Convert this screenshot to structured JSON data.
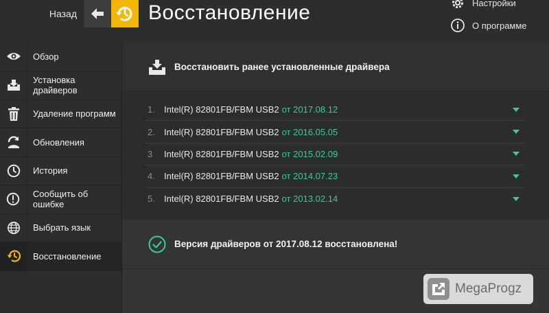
{
  "header": {
    "back_label": "Назад",
    "title": "Восстановление",
    "settings_label": "Настройки",
    "about_label": "О программе",
    "accent_color": "#f2b705"
  },
  "sidebar": {
    "items": [
      {
        "label": "Обзор",
        "icon": "eye-icon"
      },
      {
        "label": "Установка драйверов",
        "icon": "driver-install-icon"
      },
      {
        "label": "Удаление программ",
        "icon": "trash-icon"
      },
      {
        "label": "Обновления",
        "icon": "update-icon"
      },
      {
        "label": "История",
        "icon": "clock-icon"
      },
      {
        "label": "Сообщить об ошибке",
        "icon": "alert-icon"
      },
      {
        "label": "Выбрать язык",
        "icon": "globe-icon"
      },
      {
        "label": "Восстановление",
        "icon": "restore-icon",
        "active": true
      }
    ]
  },
  "main": {
    "restore_heading": "Восстановить ранее установленные драйвера",
    "drivers": [
      {
        "num": "1.",
        "name": "Intel(R) 82801FB/FBM USB2",
        "date": "от 2017.08.12"
      },
      {
        "num": "2.",
        "name": "Intel(R) 82801FB/FBM USB2",
        "date": "от 2016.05.05"
      },
      {
        "num": "3",
        "name": "Intel(R) 82801FB/FBM USB2",
        "date": "от 2015.02.09"
      },
      {
        "num": "4.",
        "name": "Intel(R) 82801FB/FBM USB2",
        "date": "от 2014.07.23"
      },
      {
        "num": "5.",
        "name": "Intel(R) 82801FB/FBM USB2",
        "date": "от 2013.02.14"
      }
    ],
    "success_message": "Версия драйверов от 2017.08.12 восстановлена!",
    "success_color": "#3fc99a"
  },
  "watermark": {
    "text": "MegaProgz"
  }
}
